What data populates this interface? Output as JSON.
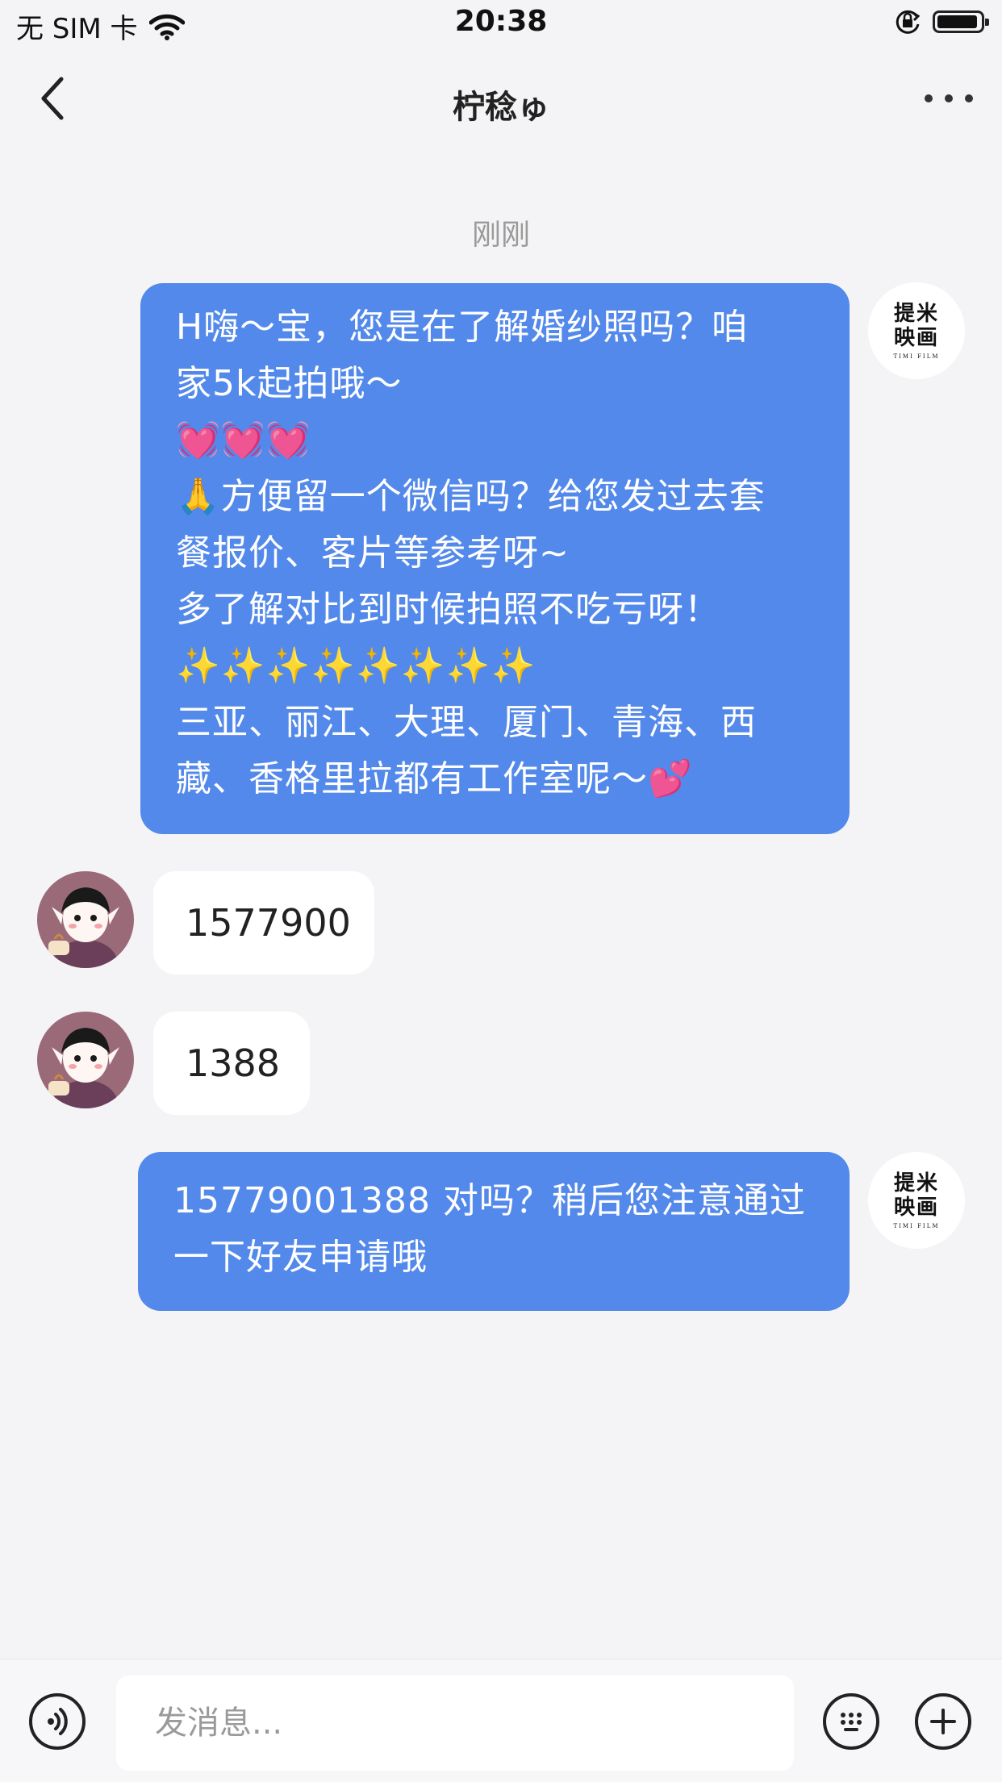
{
  "status_bar": {
    "carrier": "无 SIM 卡",
    "time": "20:38"
  },
  "nav": {
    "title": "柠稔ゅ"
  },
  "chat": {
    "timestamp": "刚刚",
    "shop_avatar": {
      "line1": "提米",
      "line2": "映画",
      "line3": "TIMI FILM"
    },
    "messages": [
      {
        "direction": "out",
        "lines": [
          "H嗨～宝，您是在了解婚纱照吗？咱",
          "家5k起拍哦～",
          "💓💓💓",
          "🙏方便留一个微信吗？给您发过去套",
          "餐报价、客片等参考呀~",
          "多了解对比到时候拍照不吃亏呀！",
          "✨✨✨✨✨✨✨✨",
          "三亚、丽江、大理、厦门、青海、西",
          "藏、香格里拉都有工作室呢～💕"
        ]
      },
      {
        "direction": "in",
        "text": "1577900"
      },
      {
        "direction": "in",
        "text": "1388"
      },
      {
        "direction": "out",
        "lines": [
          "15779001388 对吗？稍后您注意通过",
          "一下好友申请哦"
        ]
      }
    ]
  },
  "input": {
    "placeholder": "发消息..."
  },
  "colors": {
    "bubble_out": "#5389ea",
    "bubble_in": "#ffffff",
    "background": "#f4f4f6"
  }
}
